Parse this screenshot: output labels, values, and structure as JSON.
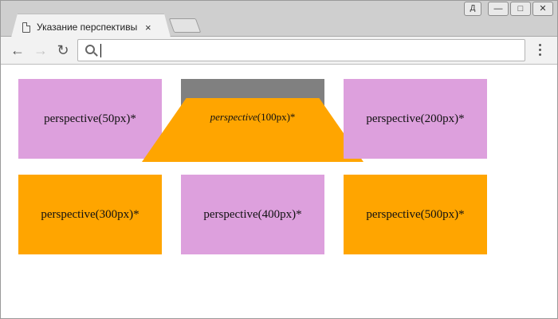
{
  "browser": {
    "tab_title": "Указание перспективы об",
    "tab_close": "×",
    "user_badge": "Д",
    "controls": {
      "minimize": "—",
      "maximize": "□",
      "close": "✕"
    },
    "back": "←",
    "forward": "→",
    "reload": "↻",
    "address_value": ""
  },
  "boxes": {
    "b50": "perspective(50px)*",
    "b100_prefix": "perspective",
    "b100_suffix": "(100px)*",
    "b200": "perspective(200px)*",
    "b300": "perspective(300px)*",
    "b400": "perspective(400px)*",
    "b500": "perspective(500px)*"
  },
  "colors": {
    "violet": "#dda0dd",
    "orange": "#ffa500",
    "gray": "#808080"
  }
}
